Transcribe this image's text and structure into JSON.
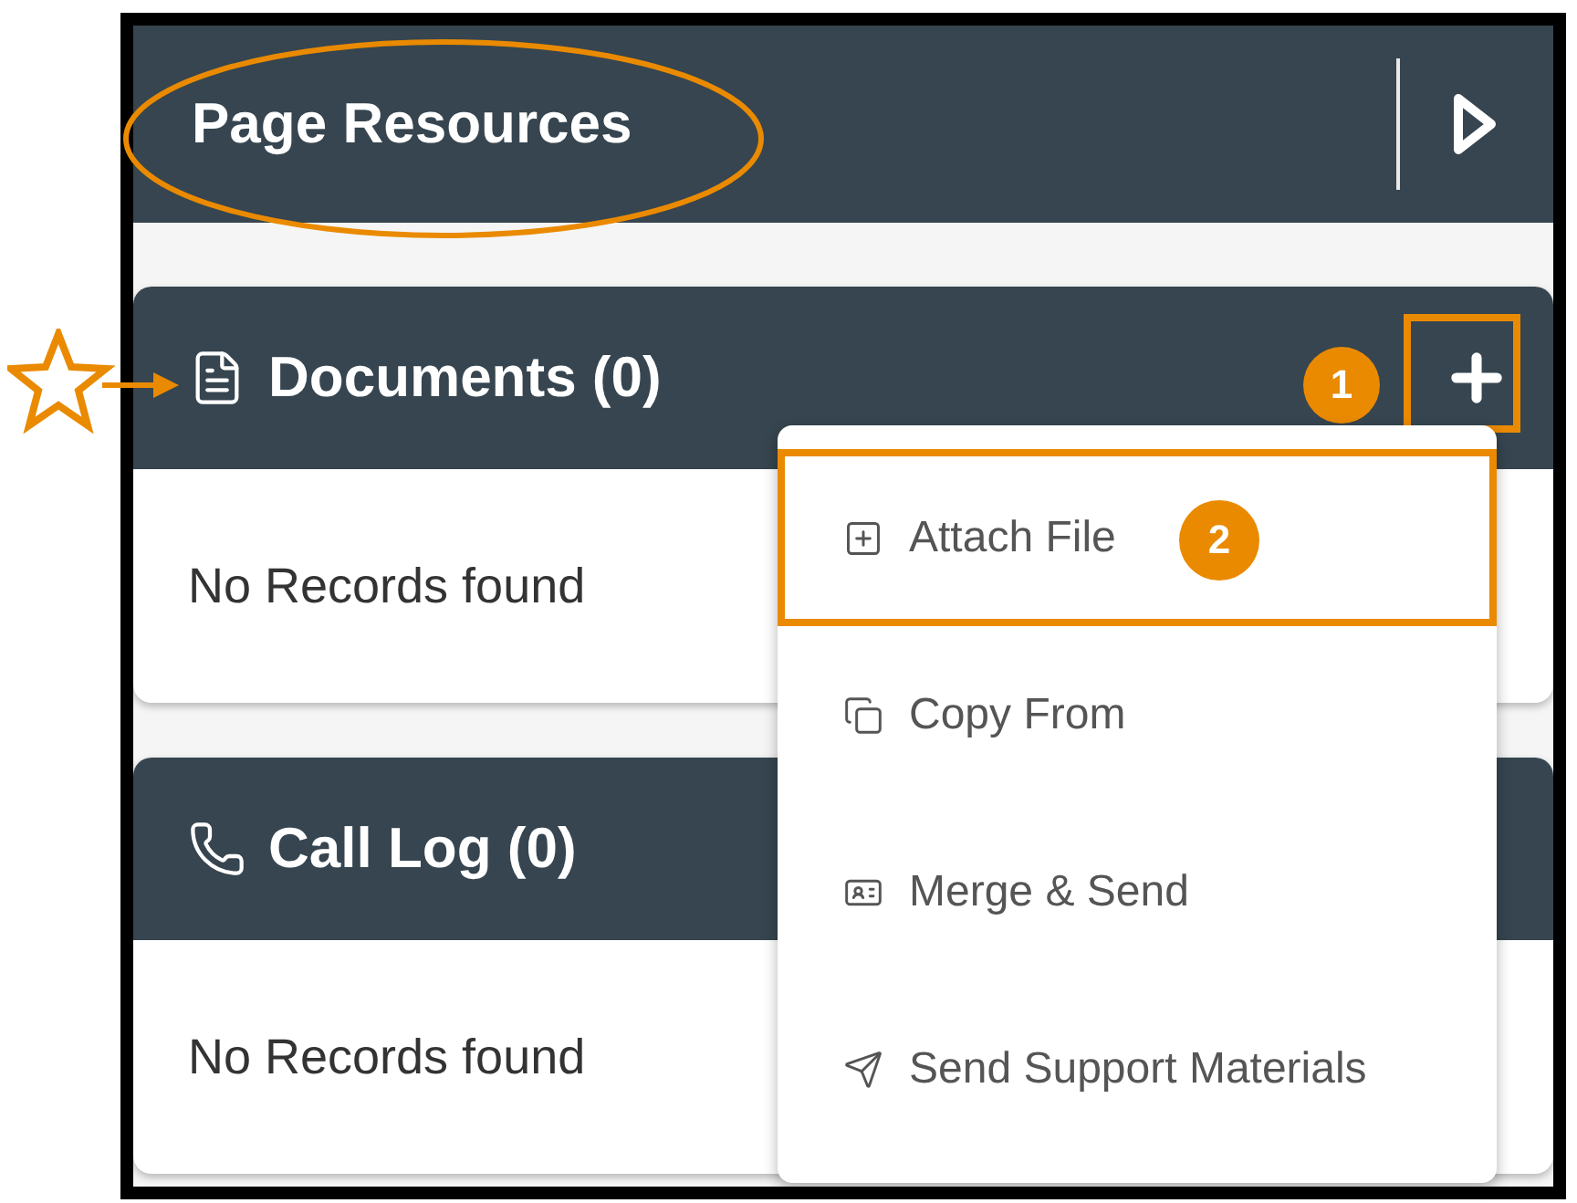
{
  "header": {
    "title": "Page Resources",
    "title_circled": true
  },
  "sections": [
    {
      "kind": "documents",
      "title": "Documents (0)",
      "empty_text": "No Records found",
      "add_button": {
        "highlighted": true,
        "badge": "1"
      },
      "starred": true
    },
    {
      "kind": "call_log",
      "title": "Call Log (0)",
      "empty_text": "No Records found"
    }
  ],
  "menu": [
    {
      "kind": "attach",
      "label": "Attach File",
      "highlighted": true,
      "badge": "2"
    },
    {
      "kind": "copy",
      "label": "Copy From",
      "highlighted": false
    },
    {
      "kind": "merge",
      "label": "Merge & Send",
      "highlighted": false
    },
    {
      "kind": "send",
      "label": "Send Support Materials",
      "highlighted": false
    }
  ]
}
